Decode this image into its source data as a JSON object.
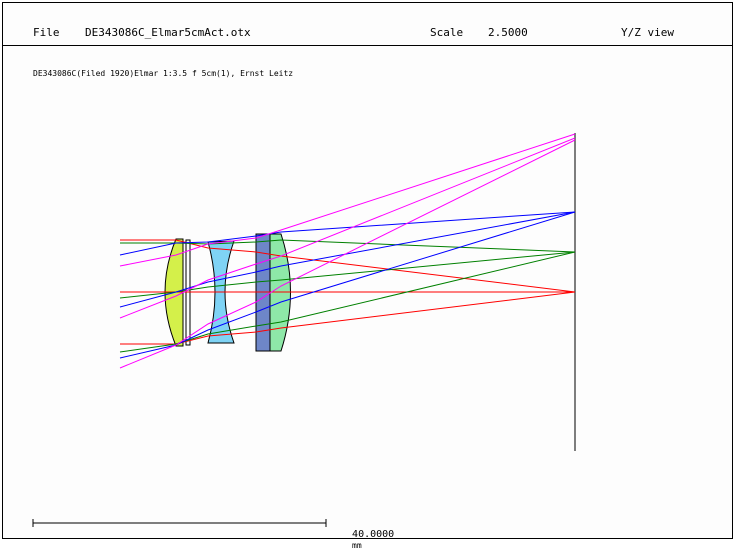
{
  "header": {
    "file_label": "File",
    "filename": "DE343086C_Elmar5cmAct.otx",
    "scale_label": "Scale",
    "scale_value": "2.5000",
    "view": "Y/Z view"
  },
  "subtitle": "DE343086C(Filed 1920)Elmar 1:3.5 f 5cm(1), Ernst Leitz",
  "scale_bar": {
    "value": "40.0000",
    "unit": "mm"
  },
  "colors": {
    "ray_axial": "#ff0000",
    "ray_mid": "#008000",
    "ray_field": "#0000ff",
    "ray_edge": "#ff00ff",
    "element_1": "#d4f04a",
    "element_2": "#7fd3f5",
    "element_3": "#6e86c8",
    "element_4": "#8ee8a8"
  }
}
